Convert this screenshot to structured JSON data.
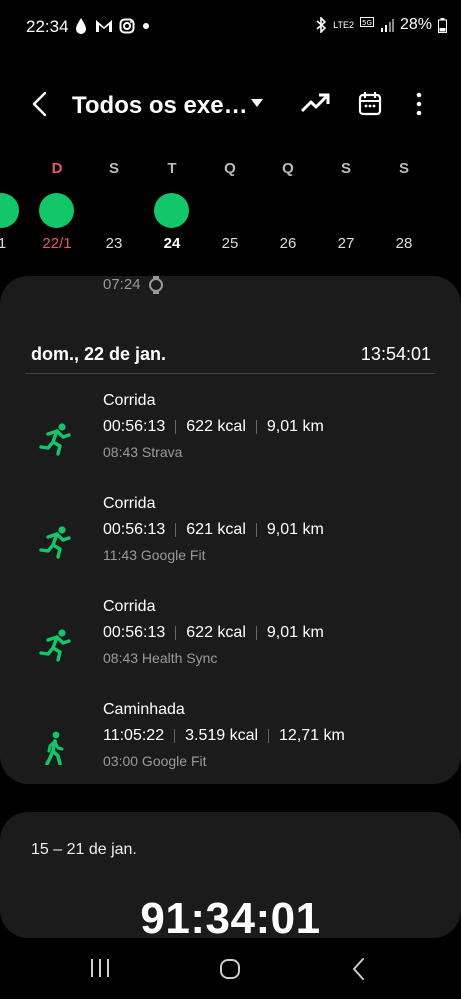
{
  "status_bar": {
    "time": "22:34",
    "battery": "28%",
    "net": "LTE2"
  },
  "header": {
    "title": "Todos os exe…"
  },
  "week": {
    "days": [
      {
        "letter": "",
        "num": "1",
        "has_workout": true
      },
      {
        "letter": "D",
        "num": "22/1",
        "has_workout": true,
        "red": true
      },
      {
        "letter": "S",
        "num": "23",
        "has_workout": false
      },
      {
        "letter": "T",
        "num": "24",
        "has_workout": true,
        "bold": true
      },
      {
        "letter": "Q",
        "num": "25",
        "has_workout": false
      },
      {
        "letter": "Q",
        "num": "26",
        "has_workout": false
      },
      {
        "letter": "S",
        "num": "27",
        "has_workout": false
      },
      {
        "letter": "S",
        "num": "28",
        "has_workout": false
      }
    ]
  },
  "prev_entry_time": "07:24",
  "day_section": {
    "date": "dom., 22 de jan.",
    "total": "13:54:01",
    "workouts": [
      {
        "name": "Corrida",
        "duration": "00:56:13",
        "kcal": "622 kcal",
        "distance": "9,01 km",
        "meta": "08:43 Strava",
        "icon": "running-icon"
      },
      {
        "name": "Corrida",
        "duration": "00:56:13",
        "kcal": "621 kcal",
        "distance": "9,01 km",
        "meta": "11:43 Google Fit",
        "icon": "running-icon"
      },
      {
        "name": "Corrida",
        "duration": "00:56:13",
        "kcal": "622 kcal",
        "distance": "9,01 km",
        "meta": "08:43 Health Sync",
        "icon": "running-icon"
      },
      {
        "name": "Caminhada",
        "duration": "11:05:22",
        "kcal": "3.519 kcal",
        "distance": "12,71 km",
        "meta": "03:00 Google Fit",
        "icon": "walking-icon"
      }
    ]
  },
  "week_section": {
    "range": "15 – 21 de jan.",
    "total": "91:34:01"
  },
  "colors": {
    "accent_green": "#12c66a",
    "sunday_red": "#e45b5b",
    "card_bg": "#1b1b1b"
  }
}
